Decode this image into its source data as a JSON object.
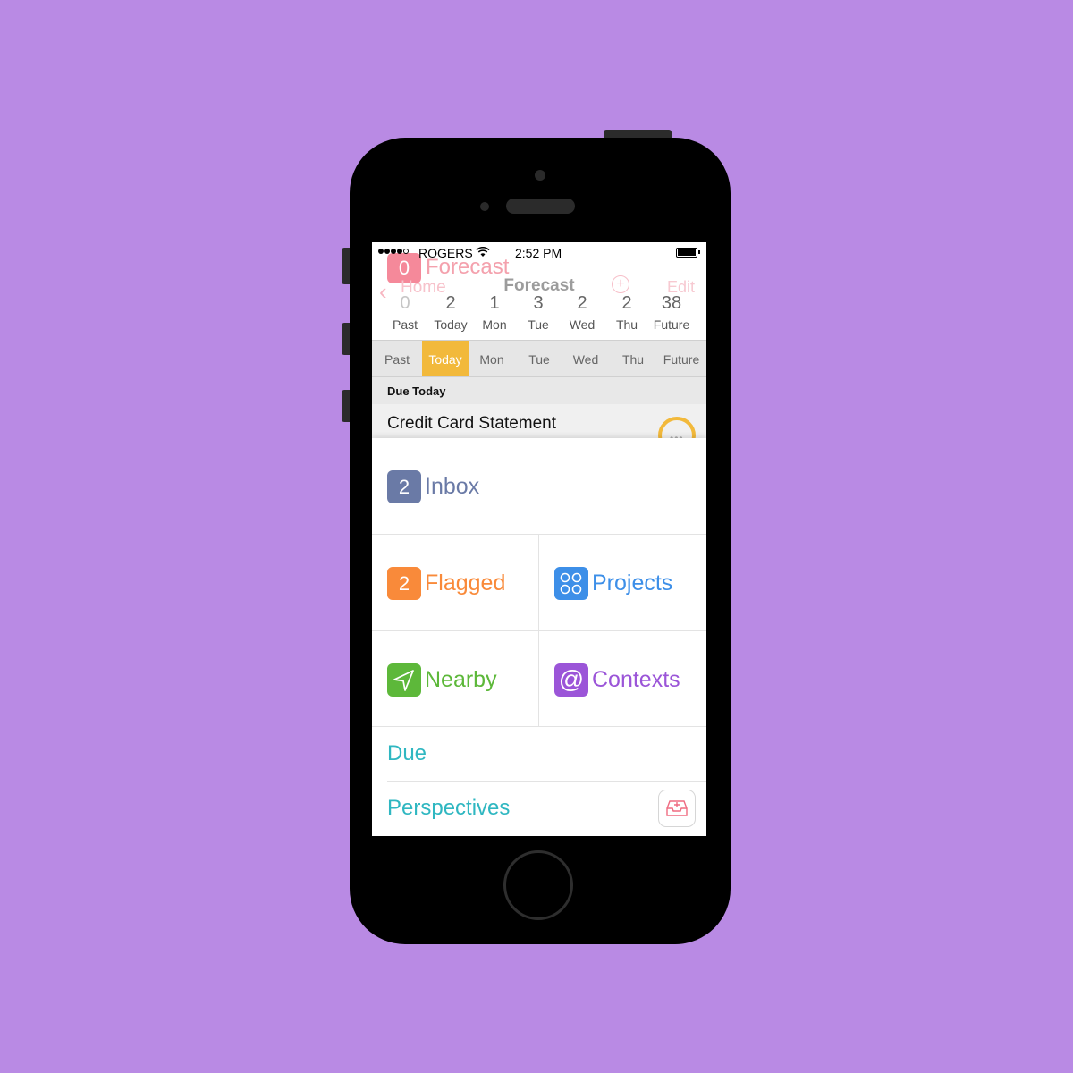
{
  "status_bar": {
    "carrier": "ROGERS",
    "time": "2:52 PM"
  },
  "header": {
    "forecast_count": "0",
    "forecast_title": "Forecast",
    "back_label": "Home",
    "nav_title": "Forecast",
    "edit_label": "Edit"
  },
  "counts": [
    {
      "num": "0",
      "label": "Past"
    },
    {
      "num": "2",
      "label": "Today"
    },
    {
      "num": "1",
      "label": "Mon"
    },
    {
      "num": "3",
      "label": "Tue"
    },
    {
      "num": "2",
      "label": "Wed"
    },
    {
      "num": "2",
      "label": "Thu"
    },
    {
      "num": "38",
      "label": "Future"
    }
  ],
  "tabs": [
    "Past",
    "Today",
    "Mon",
    "Tue",
    "Wed",
    "Thu",
    "Future"
  ],
  "active_tab": "Today",
  "section": {
    "header": "Due Today",
    "task_title": "Credit Card Statement"
  },
  "menu": {
    "inbox": {
      "count": "2",
      "label": "Inbox",
      "color": "#6a7aa6"
    },
    "flagged": {
      "count": "2",
      "label": "Flagged",
      "color": "#f98a3a"
    },
    "projects": {
      "label": "Projects",
      "color": "#3d8fe8"
    },
    "nearby": {
      "label": "Nearby",
      "color": "#5db83a"
    },
    "contexts": {
      "label": "Contexts",
      "color": "#9b55d8"
    },
    "due": {
      "label": "Due",
      "color": "#2fb7c1"
    },
    "perspectives": {
      "label": "Perspectives",
      "color": "#2fb7c1"
    }
  },
  "icons": [
    "wifi-icon",
    "battery-icon",
    "chevron-left-icon",
    "add-icon",
    "more-icon",
    "projects-icon",
    "location-arrow-icon",
    "at-icon",
    "inbox-tray-icon"
  ]
}
